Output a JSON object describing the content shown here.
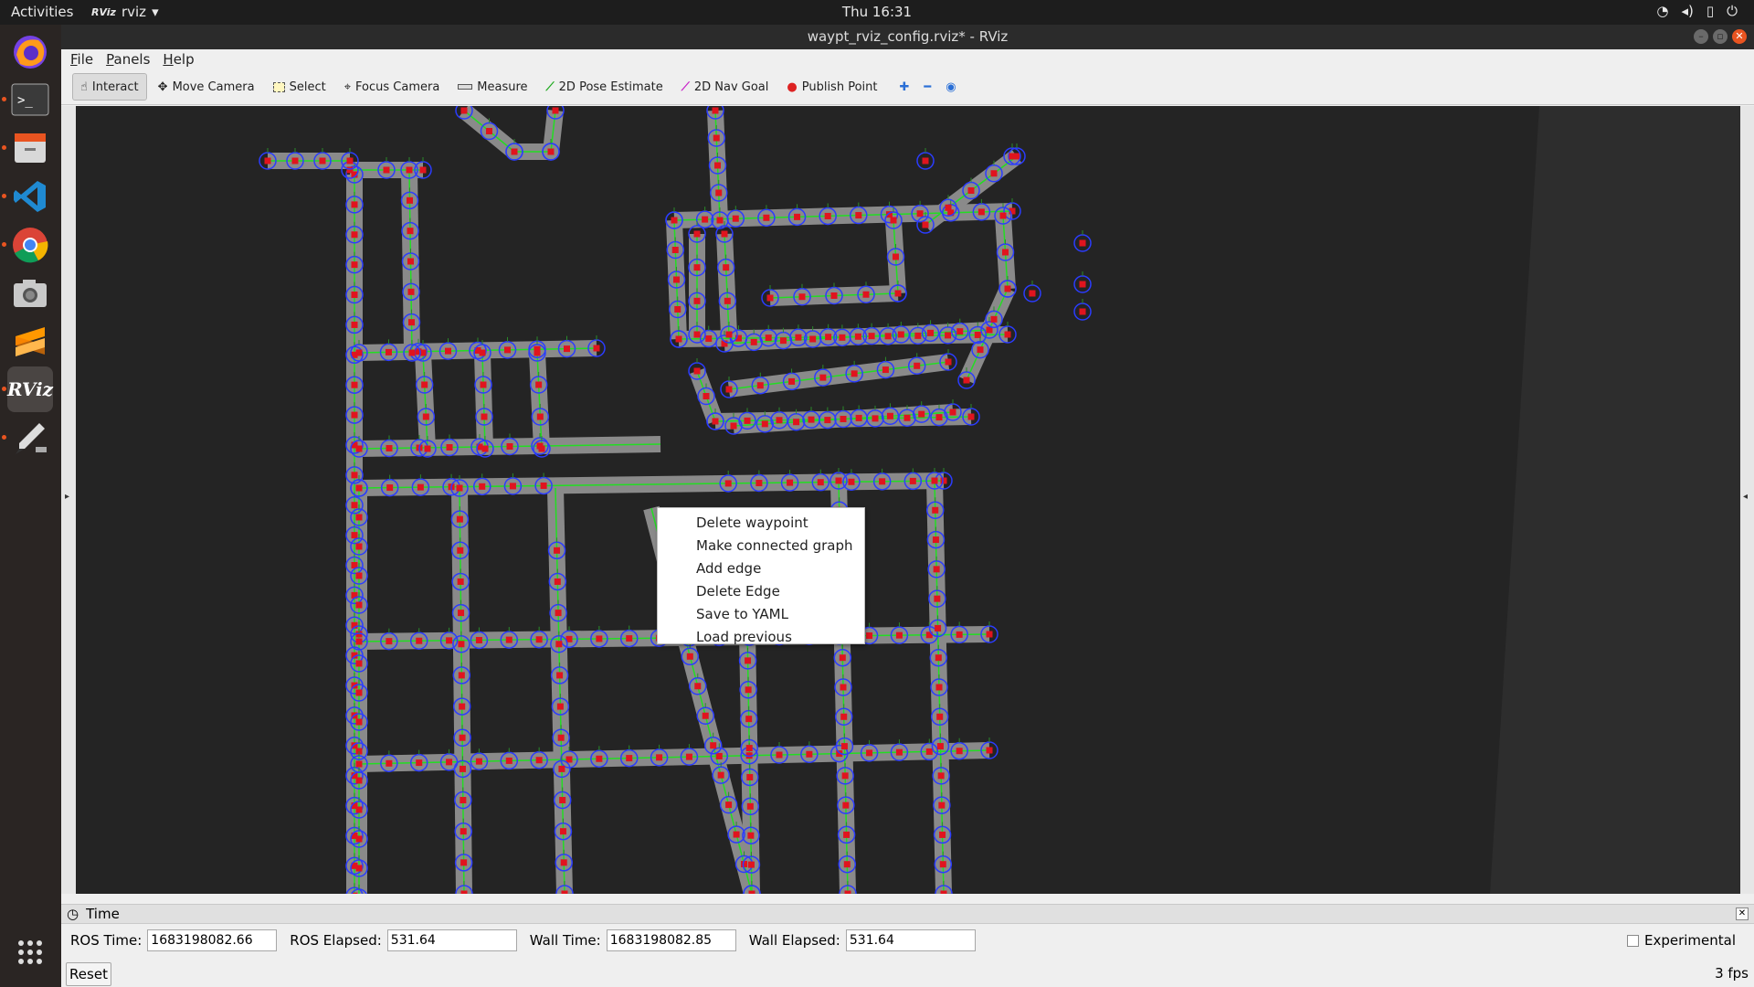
{
  "topbar": {
    "activities": "Activities",
    "app_name": "rviz",
    "app_icon_text": "RViz",
    "clock": "Thu 16:31",
    "tray_icons": [
      "wifi-icon",
      "volume-icon",
      "battery-icon",
      "power-icon"
    ]
  },
  "dock": {
    "items": [
      "firefox-icon",
      "terminal-icon",
      "files-icon",
      "vscode-icon",
      "chrome-icon",
      "screenshot-icon",
      "sublime-icon",
      "rviz-icon",
      "paint-icon"
    ],
    "rviz_label": "RViz",
    "show_apps_icon": "grid-icon"
  },
  "window": {
    "title": "waypt_rviz_config.rviz* - RViz",
    "menu": [
      "File",
      "Panels",
      "Help"
    ],
    "toolbar": {
      "tools": [
        {
          "label": "Interact",
          "icon": "hand-icon",
          "active": true
        },
        {
          "label": "Move Camera",
          "icon": "move-icon"
        },
        {
          "label": "Select",
          "icon": "select-icon"
        },
        {
          "label": "Focus Camera",
          "icon": "focus-icon"
        },
        {
          "label": "Measure",
          "icon": "ruler-icon"
        },
        {
          "label": "2D Pose Estimate",
          "icon": "pose-icon"
        },
        {
          "label": "2D Nav Goal",
          "icon": "nav-goal-icon"
        },
        {
          "label": "Publish Point",
          "icon": "pin-icon"
        }
      ],
      "extra_icons": [
        "plus-icon",
        "minus-icon",
        "eye-icon"
      ]
    }
  },
  "context_menu": {
    "items": [
      "Delete waypoint",
      "Make connected graph",
      "Add edge",
      "Delete Edge",
      "Save to YAML",
      "Load previous"
    ]
  },
  "time_panel": {
    "title": "Time",
    "ros_time_label": "ROS Time:",
    "ros_time": "1683198082.66",
    "ros_elapsed_label": "ROS Elapsed:",
    "ros_elapsed": "531.64",
    "wall_time_label": "Wall Time:",
    "wall_time": "1683198082.85",
    "wall_elapsed_label": "Wall Elapsed:",
    "wall_elapsed": "531.64",
    "experimental_label": "Experimental",
    "reset_label": "Reset",
    "fps": "3 fps"
  },
  "colors": {
    "accent": "#e95420",
    "waypoint": "#e0141e",
    "ring": "#2b3cff",
    "edge": "#22dd22",
    "road": "#8a8a8a",
    "map_bg": "#242424"
  }
}
